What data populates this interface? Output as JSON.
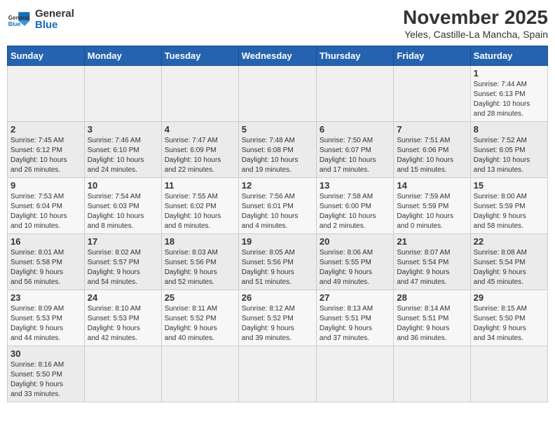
{
  "header": {
    "logo_general": "General",
    "logo_blue": "Blue",
    "title": "November 2025",
    "subtitle": "Yeles, Castille-La Mancha, Spain"
  },
  "weekdays": [
    "Sunday",
    "Monday",
    "Tuesday",
    "Wednesday",
    "Thursday",
    "Friday",
    "Saturday"
  ],
  "weeks": [
    [
      {
        "day": "",
        "info": ""
      },
      {
        "day": "",
        "info": ""
      },
      {
        "day": "",
        "info": ""
      },
      {
        "day": "",
        "info": ""
      },
      {
        "day": "",
        "info": ""
      },
      {
        "day": "",
        "info": ""
      },
      {
        "day": "1",
        "info": "Sunrise: 7:44 AM\nSunset: 6:13 PM\nDaylight: 10 hours\nand 28 minutes."
      }
    ],
    [
      {
        "day": "2",
        "info": "Sunrise: 7:45 AM\nSunset: 6:12 PM\nDaylight: 10 hours\nand 26 minutes."
      },
      {
        "day": "3",
        "info": "Sunrise: 7:46 AM\nSunset: 6:10 PM\nDaylight: 10 hours\nand 24 minutes."
      },
      {
        "day": "4",
        "info": "Sunrise: 7:47 AM\nSunset: 6:09 PM\nDaylight: 10 hours\nand 22 minutes."
      },
      {
        "day": "5",
        "info": "Sunrise: 7:48 AM\nSunset: 6:08 PM\nDaylight: 10 hours\nand 19 minutes."
      },
      {
        "day": "6",
        "info": "Sunrise: 7:50 AM\nSunset: 6:07 PM\nDaylight: 10 hours\nand 17 minutes."
      },
      {
        "day": "7",
        "info": "Sunrise: 7:51 AM\nSunset: 6:06 PM\nDaylight: 10 hours\nand 15 minutes."
      },
      {
        "day": "8",
        "info": "Sunrise: 7:52 AM\nSunset: 6:05 PM\nDaylight: 10 hours\nand 13 minutes."
      }
    ],
    [
      {
        "day": "9",
        "info": "Sunrise: 7:53 AM\nSunset: 6:04 PM\nDaylight: 10 hours\nand 10 minutes."
      },
      {
        "day": "10",
        "info": "Sunrise: 7:54 AM\nSunset: 6:03 PM\nDaylight: 10 hours\nand 8 minutes."
      },
      {
        "day": "11",
        "info": "Sunrise: 7:55 AM\nSunset: 6:02 PM\nDaylight: 10 hours\nand 6 minutes."
      },
      {
        "day": "12",
        "info": "Sunrise: 7:56 AM\nSunset: 6:01 PM\nDaylight: 10 hours\nand 4 minutes."
      },
      {
        "day": "13",
        "info": "Sunrise: 7:58 AM\nSunset: 6:00 PM\nDaylight: 10 hours\nand 2 minutes."
      },
      {
        "day": "14",
        "info": "Sunrise: 7:59 AM\nSunset: 5:59 PM\nDaylight: 10 hours\nand 0 minutes."
      },
      {
        "day": "15",
        "info": "Sunrise: 8:00 AM\nSunset: 5:59 PM\nDaylight: 9 hours\nand 58 minutes."
      }
    ],
    [
      {
        "day": "16",
        "info": "Sunrise: 8:01 AM\nSunset: 5:58 PM\nDaylight: 9 hours\nand 56 minutes."
      },
      {
        "day": "17",
        "info": "Sunrise: 8:02 AM\nSunset: 5:57 PM\nDaylight: 9 hours\nand 54 minutes."
      },
      {
        "day": "18",
        "info": "Sunrise: 8:03 AM\nSunset: 5:56 PM\nDaylight: 9 hours\nand 52 minutes."
      },
      {
        "day": "19",
        "info": "Sunrise: 8:05 AM\nSunset: 5:56 PM\nDaylight: 9 hours\nand 51 minutes."
      },
      {
        "day": "20",
        "info": "Sunrise: 8:06 AM\nSunset: 5:55 PM\nDaylight: 9 hours\nand 49 minutes."
      },
      {
        "day": "21",
        "info": "Sunrise: 8:07 AM\nSunset: 5:54 PM\nDaylight: 9 hours\nand 47 minutes."
      },
      {
        "day": "22",
        "info": "Sunrise: 8:08 AM\nSunset: 5:54 PM\nDaylight: 9 hours\nand 45 minutes."
      }
    ],
    [
      {
        "day": "23",
        "info": "Sunrise: 8:09 AM\nSunset: 5:53 PM\nDaylight: 9 hours\nand 44 minutes."
      },
      {
        "day": "24",
        "info": "Sunrise: 8:10 AM\nSunset: 5:53 PM\nDaylight: 9 hours\nand 42 minutes."
      },
      {
        "day": "25",
        "info": "Sunrise: 8:11 AM\nSunset: 5:52 PM\nDaylight: 9 hours\nand 40 minutes."
      },
      {
        "day": "26",
        "info": "Sunrise: 8:12 AM\nSunset: 5:52 PM\nDaylight: 9 hours\nand 39 minutes."
      },
      {
        "day": "27",
        "info": "Sunrise: 8:13 AM\nSunset: 5:51 PM\nDaylight: 9 hours\nand 37 minutes."
      },
      {
        "day": "28",
        "info": "Sunrise: 8:14 AM\nSunset: 5:51 PM\nDaylight: 9 hours\nand 36 minutes."
      },
      {
        "day": "29",
        "info": "Sunrise: 8:15 AM\nSunset: 5:50 PM\nDaylight: 9 hours\nand 34 minutes."
      }
    ],
    [
      {
        "day": "30",
        "info": "Sunrise: 8:16 AM\nSunset: 5:50 PM\nDaylight: 9 hours\nand 33 minutes."
      },
      {
        "day": "",
        "info": ""
      },
      {
        "day": "",
        "info": ""
      },
      {
        "day": "",
        "info": ""
      },
      {
        "day": "",
        "info": ""
      },
      {
        "day": "",
        "info": ""
      },
      {
        "day": "",
        "info": ""
      }
    ]
  ]
}
